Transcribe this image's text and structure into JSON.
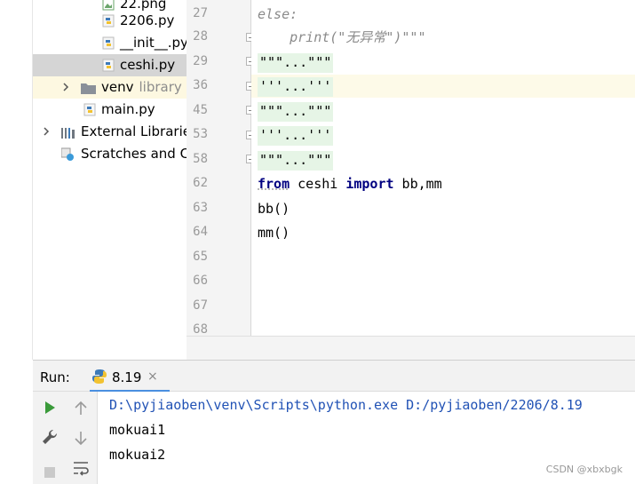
{
  "project_tree": {
    "items": [
      {
        "label": "22.png",
        "type": "image"
      },
      {
        "label": "2206.py",
        "type": "python"
      },
      {
        "label": "__init__.py",
        "type": "python"
      },
      {
        "label": "ceshi.py",
        "type": "python",
        "selected": true
      },
      {
        "label": "venv",
        "suffix": "library r",
        "type": "folder"
      },
      {
        "label": "main.py",
        "type": "python"
      },
      {
        "label": "External Librarie",
        "type": "library"
      },
      {
        "label": "Scratches and Co",
        "type": "scratch"
      }
    ]
  },
  "editor": {
    "lines": [
      {
        "no": "27",
        "text": "else:"
      },
      {
        "no": "28",
        "text": "    print(\"无异常\")\"\"\""
      },
      {
        "no": "29",
        "text": "\"\"\"...\"\"\""
      },
      {
        "no": "36",
        "text": "'''...'''"
      },
      {
        "no": "45",
        "text": "\"\"\"...\"\"\""
      },
      {
        "no": "53",
        "text": "'''...'''"
      },
      {
        "no": "58",
        "text": "\"\"\"...\"\"\""
      },
      {
        "no": "62",
        "kw1": "from",
        "mid": " ceshi ",
        "kw2": "import",
        "rest": " bb,mm"
      },
      {
        "no": "63",
        "text": "bb()"
      },
      {
        "no": "64",
        "text": "mm()"
      },
      {
        "no": "65",
        "text": ""
      },
      {
        "no": "66",
        "text": ""
      },
      {
        "no": "67",
        "text": ""
      },
      {
        "no": "68",
        "text": ""
      }
    ]
  },
  "run_panel": {
    "label": "Run:",
    "tab_name": "8.19",
    "tab_close": "×",
    "console": [
      "D:\\pyjiaoben\\venv\\Scripts\\python.exe D:/pyjiaoben/2206/8.19",
      "mokuai1",
      "mokuai2"
    ]
  },
  "icons": {
    "run": "play-icon",
    "up": "arrow-up-icon",
    "down": "arrow-down-icon",
    "wrench": "wrench-icon",
    "stop": "stop-icon",
    "wrap": "soft-wrap-icon"
  },
  "colors": {
    "keyword": "#000080",
    "comment": "#8a8a8a",
    "selected_row": "#d5d5d5",
    "current_line": "#fdfae8",
    "folded_region": "#e6f5e6",
    "console_command": "#2152b5",
    "run_green": "#3a9a3a"
  },
  "watermark": "CSDN @xbxbgk"
}
